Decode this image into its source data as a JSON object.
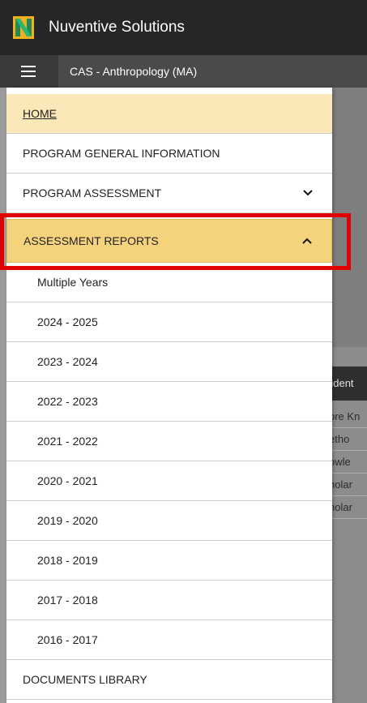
{
  "header": {
    "app_title": "Nuventive Solutions"
  },
  "subheader": {
    "context_title": "CAS - Anthropology (MA)"
  },
  "nav": {
    "home": "HOME",
    "program_general_information": "PROGRAM GENERAL INFORMATION",
    "program_assessment": "PROGRAM ASSESSMENT",
    "assessment_reports": "ASSESSMENT REPORTS",
    "documents_library": "DOCUMENTS LIBRARY"
  },
  "assessment_reports_items": [
    "Multiple Years",
    "2024 - 2025",
    "2023 - 2024",
    "2022 - 2023",
    "2021 - 2022",
    "2020 - 2021",
    "2019 - 2020",
    "2018 - 2019",
    "2017 - 2018",
    "2016 - 2017"
  ],
  "background": {
    "table_header": "udent",
    "rows": [
      "ore Kn",
      "etho",
      "owle",
      "holar",
      "holar"
    ]
  },
  "colors": {
    "topbar": "#262626",
    "home_bg": "#fbe8b8",
    "active_bg": "#f5d27c",
    "highlight": "#e00000"
  }
}
